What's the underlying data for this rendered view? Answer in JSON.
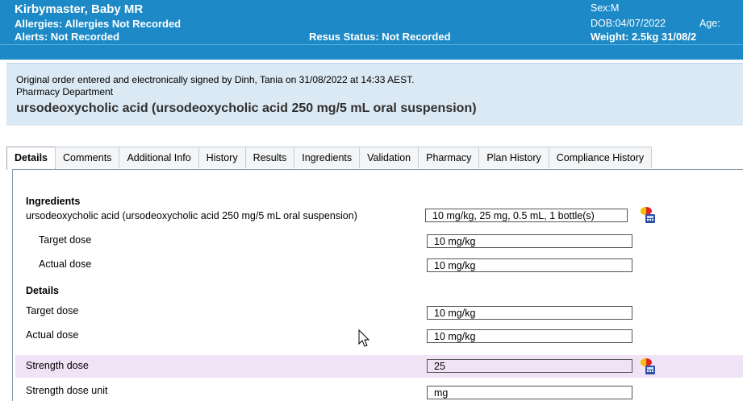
{
  "banner": {
    "name": "Kirbymaster, Baby   MR",
    "allergies": "Allergies: Allergies Not Recorded",
    "alerts": "Alerts: Not Recorded",
    "resus": "Resus Status: Not Recorded",
    "sex": "Sex:M",
    "dob": "DOB:04/07/2022",
    "age": "Age:",
    "weight": "Weight: 2.5kg  31/08/2"
  },
  "order": {
    "signed": "Original order entered and electronically signed by Dinh, Tania on 31/08/2022 at 14:33 AEST.",
    "department": "Pharmacy Department",
    "drug": "ursodeoxycholic acid (ursodeoxycholic acid 250 mg/5 mL oral suspension)"
  },
  "tabs": [
    "Details",
    "Comments",
    "Additional Info",
    "History",
    "Results",
    "Ingredients",
    "Validation",
    "Pharmacy",
    "Plan History",
    "Compliance History"
  ],
  "ingredients": {
    "heading": "Ingredients",
    "item_label": "ursodeoxycholic acid (ursodeoxycholic acid 250 mg/5 mL oral suspension)",
    "item_value": "10 mg/kg, 25 mg, 0.5 mL, 1 bottle(s)",
    "target_label": "Target dose",
    "target_value": "10 mg/kg",
    "actual_label": "Actual dose",
    "actual_value": "10 mg/kg"
  },
  "details": {
    "heading": "Details",
    "target_label": "Target dose",
    "target_value": "10 mg/kg",
    "actual_label": "Actual dose",
    "actual_value": "10 mg/kg",
    "strength_label": "Strength dose",
    "strength_value": "25",
    "strength_unit_label": "Strength dose unit",
    "strength_unit_value": "mg"
  },
  "icons": {
    "dose_calculator": "dose-calculator-icon",
    "cursor": "mouse-pointer-icon"
  },
  "colors": {
    "banner": "#1d8ac7",
    "order_header": "#dbe9f4",
    "highlight_row": "#f1e3f6"
  }
}
